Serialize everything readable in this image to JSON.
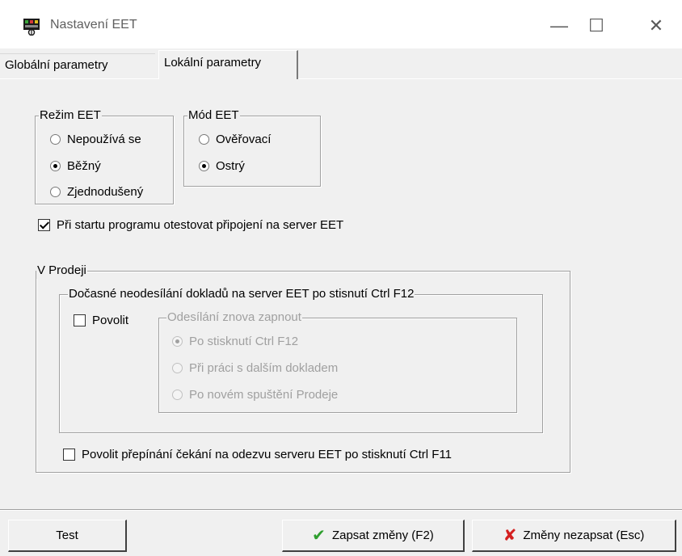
{
  "window": {
    "title": "Nastavení EET",
    "app_icon": "eet-app-icon",
    "controls": {
      "minimize": "—",
      "maximize": "☐",
      "close": "✕"
    }
  },
  "tabs": [
    {
      "label": "Globální parametry",
      "active": false
    },
    {
      "label": "Lokální parametry",
      "active": true
    }
  ],
  "rezim": {
    "legend": "Režim EET",
    "options": [
      {
        "label": "Nepoužívá se",
        "checked": false
      },
      {
        "label": "Běžný",
        "checked": true
      },
      {
        "label": "Zjednodušený",
        "checked": false
      }
    ]
  },
  "mod": {
    "legend": "Mód EET",
    "options": [
      {
        "label": "Ověřovací",
        "checked": false
      },
      {
        "label": "Ostrý",
        "checked": true
      }
    ]
  },
  "startup_check": {
    "label": "Při startu programu otestovat připojení na server EET",
    "checked": true
  },
  "prodej": {
    "legend": "V Prodeji",
    "temp": {
      "legend": "Dočasné neodesílání dokladů na server EET po stisnutí Ctrl F12",
      "allow": {
        "label": "Povolit",
        "checked": false
      },
      "resend": {
        "legend": "Odesílání znova zapnout",
        "options": [
          {
            "label": "Po stisknutí Ctrl F12",
            "checked": true
          },
          {
            "label": "Při práci s dalším dokladem",
            "checked": false
          },
          {
            "label": "Po novém spuštění Prodeje",
            "checked": false
          }
        ]
      }
    },
    "toggle_wait": {
      "label": "Povolit přepínání čekání na odezvu serveru EET po stisknutí Ctrl F11",
      "checked": false
    }
  },
  "buttons": {
    "test": "Test",
    "save": "Zapsat změny (F2)",
    "cancel": "Změny nezapsat (Esc)",
    "save_icon": "green-checkmark-icon",
    "cancel_icon": "red-x-icon",
    "save_color": "#2e9e2e",
    "cancel_color": "#d42020"
  }
}
